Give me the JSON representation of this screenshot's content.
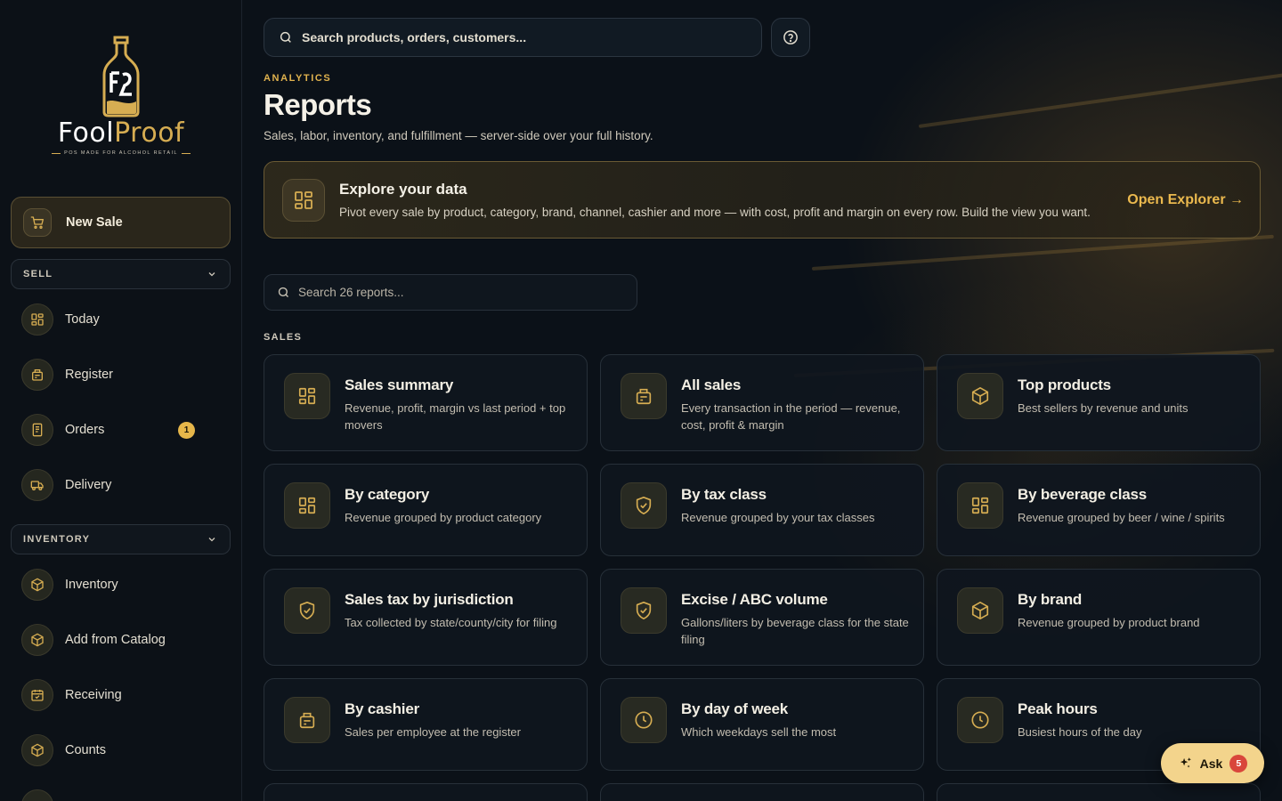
{
  "brand": {
    "name_part1": "Fool",
    "name_part2": "Proof",
    "tagline": "POS MADE FOR ALCOHOL RETAIL",
    "accent": "#e0b24e"
  },
  "sidebar": {
    "new_sale": {
      "label": "New Sale",
      "icon": "cart-icon"
    },
    "groups": [
      {
        "label": "SELL",
        "items": [
          {
            "label": "Today",
            "icon": "grid-icon"
          },
          {
            "label": "Register",
            "icon": "register-icon"
          },
          {
            "label": "Orders",
            "icon": "receipt-icon",
            "badge": "1"
          },
          {
            "label": "Delivery",
            "icon": "truck-icon"
          }
        ]
      },
      {
        "label": "INVENTORY",
        "items": [
          {
            "label": "Inventory",
            "icon": "box-icon"
          },
          {
            "label": "Add from Catalog",
            "icon": "box-icon"
          },
          {
            "label": "Receiving",
            "icon": "calendar-check-icon"
          },
          {
            "label": "Counts",
            "icon": "box-icon"
          }
        ]
      }
    ]
  },
  "topbar": {
    "search_placeholder": "Search products, orders, customers...",
    "help_icon": "question-circle-icon"
  },
  "header": {
    "eyebrow": "ANALYTICS",
    "title": "Reports",
    "subtitle": "Sales, labor, inventory, and fulfillment — server-side over your full history."
  },
  "explorer": {
    "title": "Explore your data",
    "description": "Pivot every sale by product, category, brand, channel, cashier and more — with cost, profit and margin on every row. Build the view you want.",
    "link": "Open Explorer →"
  },
  "reports_search": {
    "placeholder": "Search 26 reports..."
  },
  "section": {
    "label": "SALES"
  },
  "cards": [
    {
      "title": "Sales summary",
      "desc": "Revenue, profit, margin vs last period + top movers",
      "icon": "grid-icon"
    },
    {
      "title": "All sales",
      "desc": "Every transaction in the period — revenue, cost, profit & margin",
      "icon": "register-icon"
    },
    {
      "title": "Top products",
      "desc": "Best sellers by revenue and units",
      "icon": "box-icon"
    },
    {
      "title": "By category",
      "desc": "Revenue grouped by product category",
      "icon": "grid-icon"
    },
    {
      "title": "By tax class",
      "desc": "Revenue grouped by your tax classes",
      "icon": "shield-check-icon"
    },
    {
      "title": "By beverage class",
      "desc": "Revenue grouped by beer / wine / spirits",
      "icon": "grid-icon"
    },
    {
      "title": "Sales tax by jurisdiction",
      "desc": "Tax collected by state/county/city for filing",
      "icon": "shield-check-icon"
    },
    {
      "title": "Excise / ABC volume",
      "desc": "Gallons/liters by beverage class for the state filing",
      "icon": "shield-check-icon"
    },
    {
      "title": "By brand",
      "desc": "Revenue grouped by product brand",
      "icon": "box-icon"
    },
    {
      "title": "By cashier",
      "desc": "Sales per employee at the register",
      "icon": "register-icon"
    },
    {
      "title": "By day of week",
      "desc": "Which weekdays sell the most",
      "icon": "clock-icon"
    },
    {
      "title": "Peak hours",
      "desc": "Busiest hours of the day",
      "icon": "clock-icon"
    }
  ],
  "ask": {
    "label": "Ask",
    "badge": "5",
    "icon": "sparkle-icon"
  }
}
